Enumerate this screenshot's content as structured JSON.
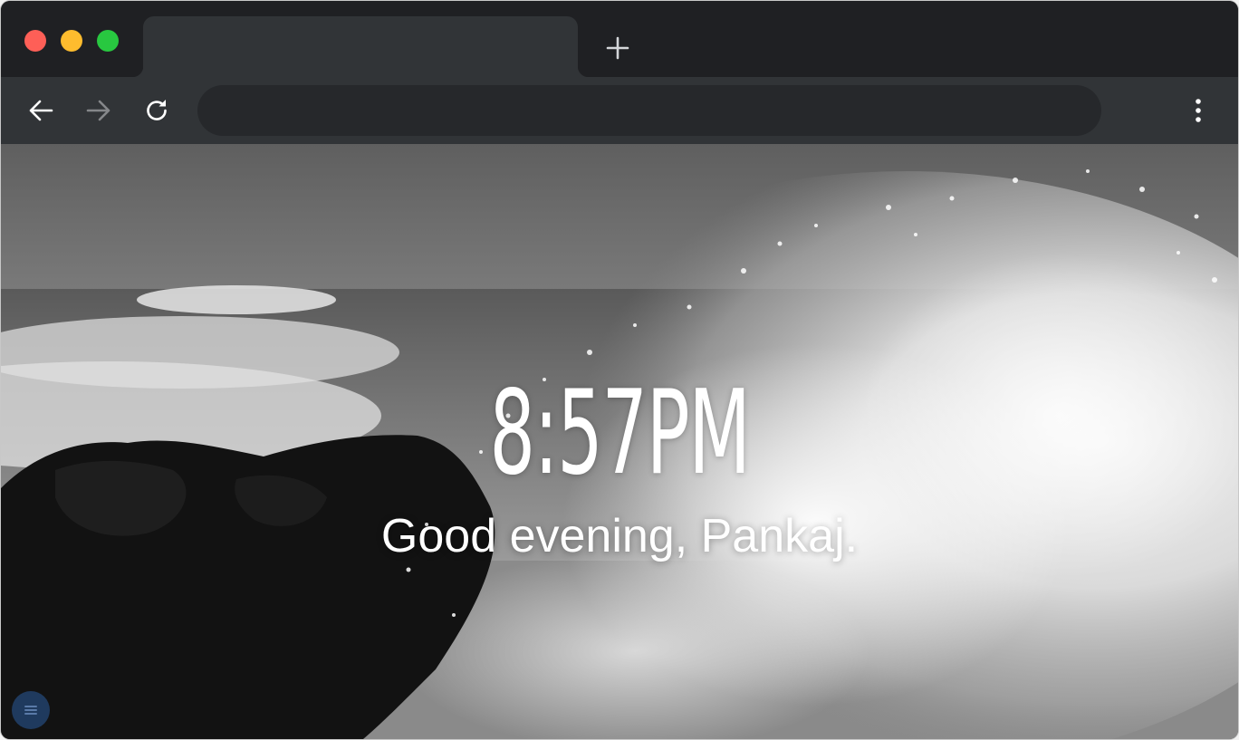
{
  "window": {
    "controls": {
      "close_color": "#fe5f57",
      "minimize_color": "#febc2e",
      "zoom_color": "#28c840"
    },
    "tab": {
      "title": ""
    },
    "new_tab_icon": "plus-icon"
  },
  "toolbar": {
    "back_icon": "arrow-left-icon",
    "forward_icon": "arrow-right-icon",
    "reload_icon": "reload-icon",
    "address": {
      "value": "",
      "placeholder": ""
    },
    "menu_icon": "vertical-dots-icon"
  },
  "page": {
    "background": "grayscale photo of ocean waves crashing on dark rocks",
    "clock": "8:57PM",
    "greeting": "Good evening, Pankaj.",
    "menu_button_icon": "hamburger-menu-icon",
    "accent_color": "#1f3a5e"
  }
}
